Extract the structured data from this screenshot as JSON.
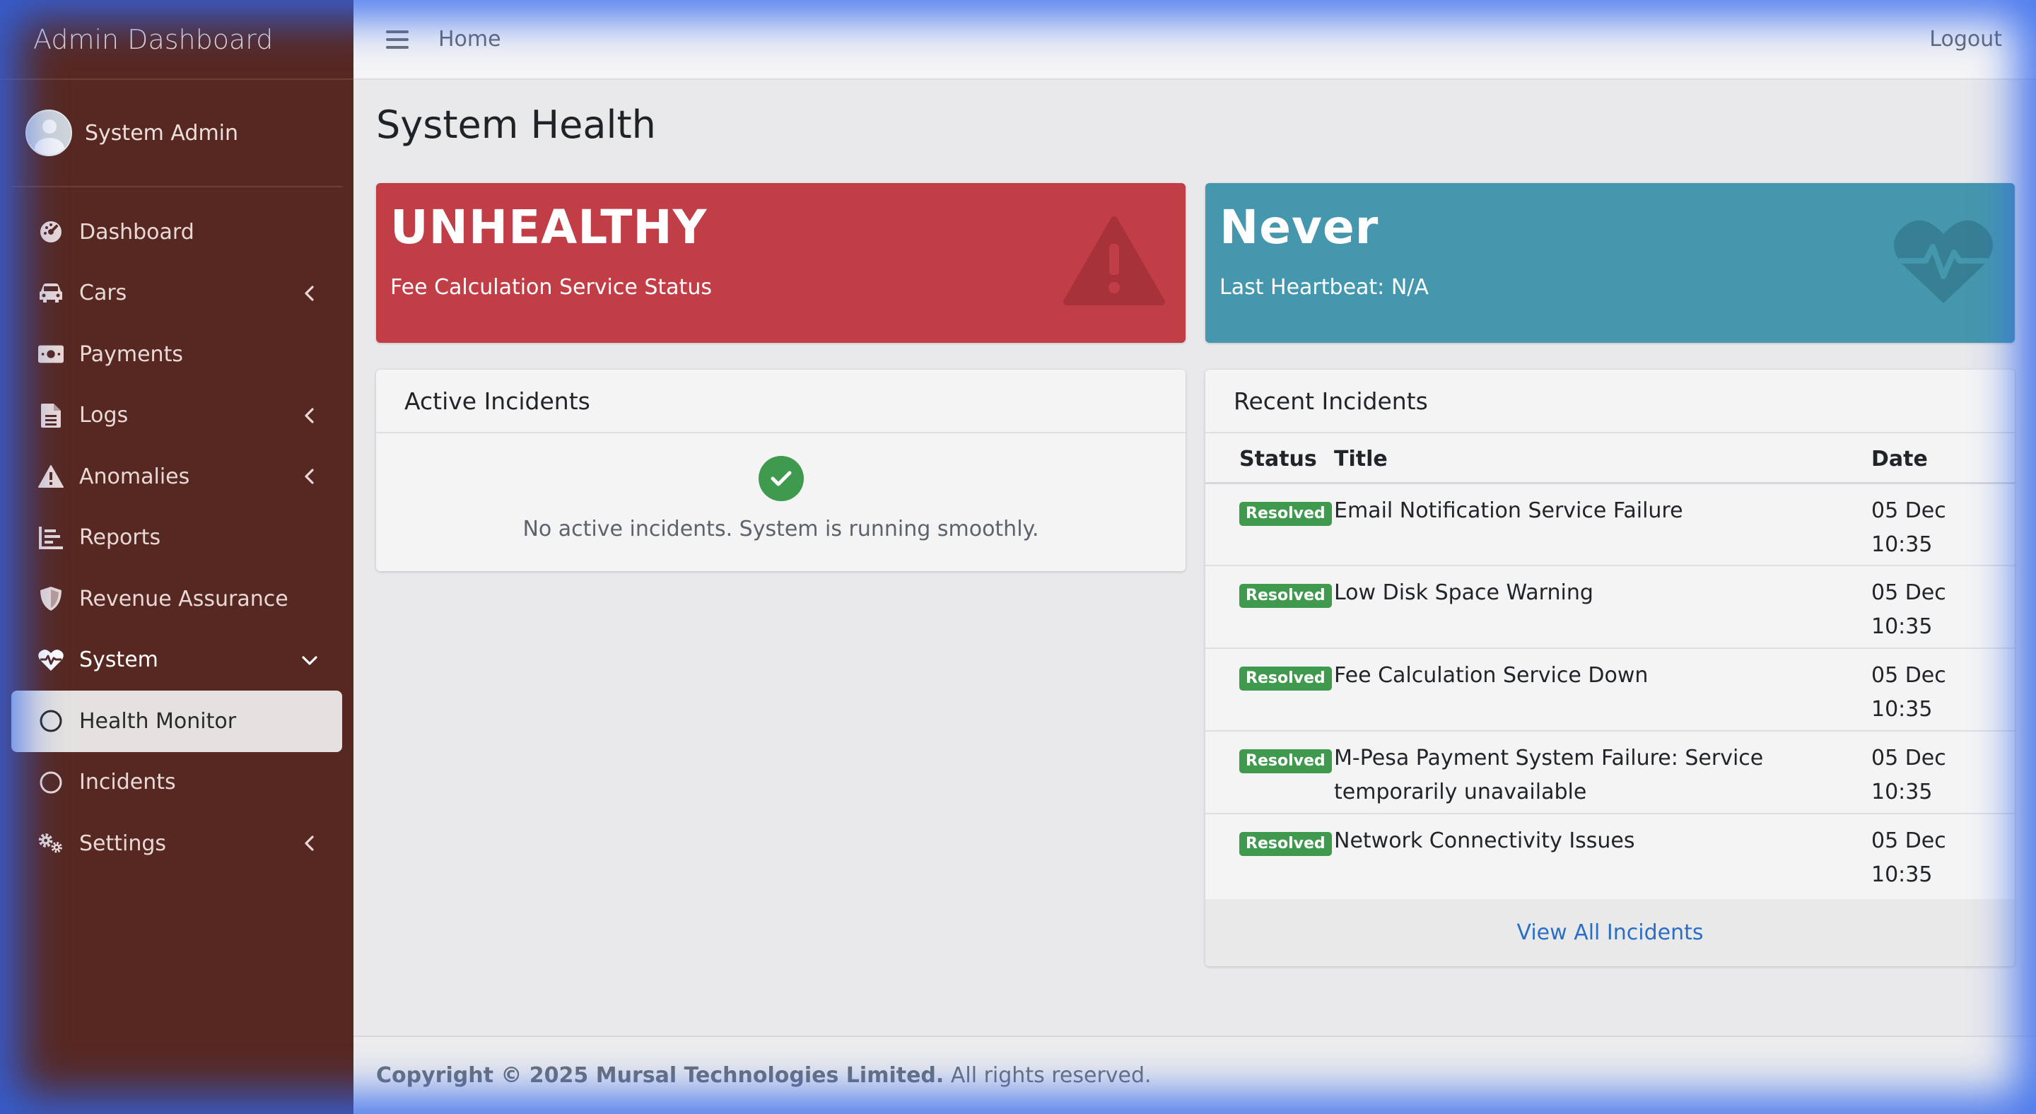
{
  "sidebar": {
    "brand": "Admin Dashboard",
    "user_name": "System Admin",
    "items": [
      {
        "label": "Dashboard",
        "icon": "gauge-icon"
      },
      {
        "label": "Cars",
        "icon": "car-icon"
      },
      {
        "label": "Payments",
        "icon": "money-icon"
      },
      {
        "label": "Logs",
        "icon": "file-icon"
      },
      {
        "label": "Anomalies",
        "icon": "warning-icon"
      },
      {
        "label": "Reports",
        "icon": "chart-icon"
      },
      {
        "label": "Revenue Assurance",
        "icon": "shield-icon"
      },
      {
        "label": "System",
        "icon": "heartbeat-icon"
      },
      {
        "label": "Health Monitor",
        "icon": "circle-icon"
      },
      {
        "label": "Incidents",
        "icon": "circle-icon"
      },
      {
        "label": "Settings",
        "icon": "gears-icon"
      }
    ]
  },
  "topbar": {
    "home": "Home",
    "logout": "Logout"
  },
  "main": {
    "title": "System Health",
    "status_box": {
      "value": "UNHEALTHY",
      "label": "Fee Calculation Service Status",
      "color": "#c23e47"
    },
    "heartbeat_box": {
      "value": "Never",
      "label": "Last Heartbeat: N/A",
      "color": "#4597ad"
    },
    "active_incidents": {
      "title": "Active Incidents",
      "message": "No active incidents. System is running smoothly."
    },
    "recent_incidents": {
      "title": "Recent Incidents",
      "columns": [
        "Status",
        "Title",
        "Date"
      ],
      "rows": [
        {
          "status": "Resolved",
          "title": "Email Notification Service Failure",
          "date_line1": "05 Dec",
          "date_line2": "10:35"
        },
        {
          "status": "Resolved",
          "title": "Low Disk Space Warning",
          "date_line1": "05 Dec",
          "date_line2": "10:35"
        },
        {
          "status": "Resolved",
          "title": "Fee Calculation Service Down",
          "date_line1": "05 Dec",
          "date_line2": "10:35"
        },
        {
          "status": "Resolved",
          "title": "M-Pesa Payment System Failure: Service temporarily unavailable",
          "date_line1": "05 Dec",
          "date_line2": "10:35"
        },
        {
          "status": "Resolved",
          "title": "Network Connectivity Issues",
          "date_line1": "05 Dec",
          "date_line2": "10:35"
        }
      ],
      "view_all": "View All Incidents"
    }
  },
  "footer": {
    "copyright": "Copyright © 2025 Mursal Technologies Limited.",
    "rights": "All rights reserved."
  },
  "colors": {
    "sidebar_bg": "#572822",
    "success": "#3f9a4e",
    "link": "#2a6ec6"
  }
}
